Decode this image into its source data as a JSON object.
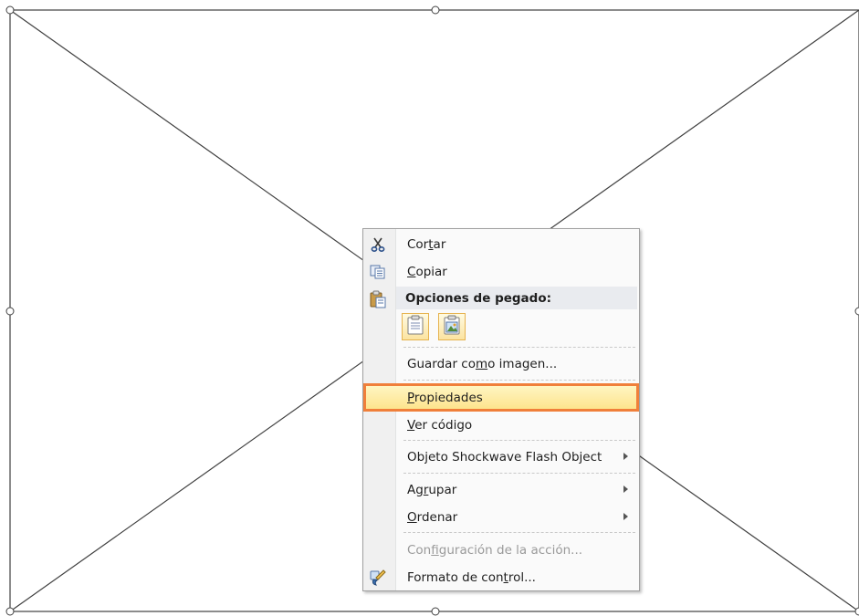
{
  "menu": {
    "cut": {
      "label_pre": "Cor",
      "label_key": "t",
      "label_post": "ar",
      "icon": "scissors-icon"
    },
    "copy": {
      "label_key": "C",
      "label_post": "opiar",
      "icon": "copy-icon"
    },
    "paste_header": {
      "label": "Opciones de pegado:",
      "icon": "paste-icon"
    },
    "paste_options": [
      {
        "icon": "paste-keep-source-icon"
      },
      {
        "icon": "paste-as-picture-icon"
      }
    ],
    "save_as_image": {
      "label_pre": "Guardar co",
      "label_key": "m",
      "label_post": "o imagen..."
    },
    "properties": {
      "label_key": "P",
      "label_post": "ropiedades"
    },
    "view_code": {
      "label_key": "V",
      "label_post": "er código"
    },
    "flash_object": {
      "label_pre": "Ob",
      "label_key": "j",
      "label_post": "eto Shockwave Flash Object"
    },
    "group": {
      "label_pre": "Ag",
      "label_key": "r",
      "label_post": "upar"
    },
    "order": {
      "label_key": "O",
      "label_post": "rdenar"
    },
    "action_settings": {
      "label_pre": "Con",
      "label_key": "f",
      "label_post": "iguración de la acción..."
    },
    "format_control": {
      "label_pre": "Formato de con",
      "label_key": "t",
      "label_post": "rol...",
      "icon": "format-control-icon"
    }
  },
  "colors": {
    "highlight_border": "#f07f3a",
    "highlight_fill": "#fde38b",
    "menu_background": "#fafafa"
  }
}
